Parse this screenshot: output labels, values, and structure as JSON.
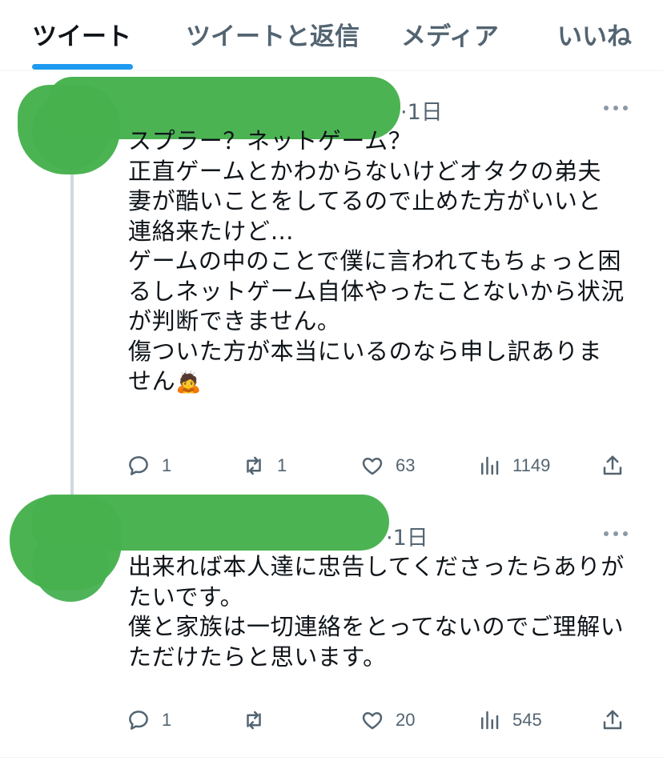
{
  "tabs": [
    {
      "label": "ツイート",
      "active": true
    },
    {
      "label": "ツイートと返信",
      "active": false
    },
    {
      "label": "メディア",
      "active": false
    },
    {
      "label": "いいね",
      "active": false
    }
  ],
  "tweets": [
    {
      "date": "·1日",
      "text": "スプラー？ネットゲーム？\n正直ゲームとかわからないけどオタクの弟夫妻が酷いことをしてるので止めた方がいいと連絡来たけど…\nゲームの中のことで僕に言われてもちょっと困るしネットゲーム自体やったことないから状況が判断できません。\n傷ついた方が本当にいるのなら申し訳ありません",
      "emoji": "🙇",
      "replies": "1",
      "retweets": "1",
      "likes": "63",
      "views": "1149"
    },
    {
      "date": "·1日",
      "text": "出来れば本人達に忠告してくださったらありがたいです。\n僕と家族は一切連絡をとってないのでご理解いただけたらと思います。",
      "replies": "1",
      "retweets": "",
      "likes": "20",
      "views": "545"
    }
  ],
  "colors": {
    "accent": "#1d9bf0",
    "redaction": "#46b14d",
    "secondary_text": "#536471"
  },
  "icons": [
    "reply-icon",
    "retweet-icon",
    "like-icon",
    "views-icon",
    "share-icon",
    "more-icon"
  ]
}
